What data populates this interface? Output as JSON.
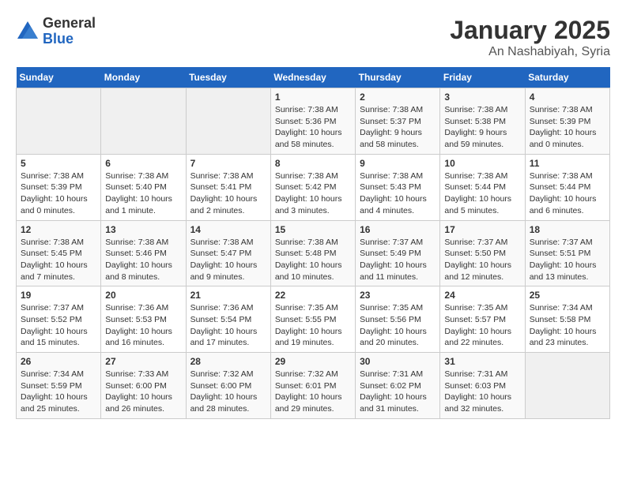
{
  "logo": {
    "general": "General",
    "blue": "Blue"
  },
  "title": "January 2025",
  "subtitle": "An Nashabiyah, Syria",
  "headers": [
    "Sunday",
    "Monday",
    "Tuesday",
    "Wednesday",
    "Thursday",
    "Friday",
    "Saturday"
  ],
  "weeks": [
    [
      {
        "day": "",
        "info": ""
      },
      {
        "day": "",
        "info": ""
      },
      {
        "day": "",
        "info": ""
      },
      {
        "day": "1",
        "info": "Sunrise: 7:38 AM\nSunset: 5:36 PM\nDaylight: 10 hours\nand 58 minutes."
      },
      {
        "day": "2",
        "info": "Sunrise: 7:38 AM\nSunset: 5:37 PM\nDaylight: 9 hours\nand 58 minutes."
      },
      {
        "day": "3",
        "info": "Sunrise: 7:38 AM\nSunset: 5:38 PM\nDaylight: 9 hours\nand 59 minutes."
      },
      {
        "day": "4",
        "info": "Sunrise: 7:38 AM\nSunset: 5:39 PM\nDaylight: 10 hours\nand 0 minutes."
      }
    ],
    [
      {
        "day": "5",
        "info": "Sunrise: 7:38 AM\nSunset: 5:39 PM\nDaylight: 10 hours\nand 0 minutes."
      },
      {
        "day": "6",
        "info": "Sunrise: 7:38 AM\nSunset: 5:40 PM\nDaylight: 10 hours\nand 1 minute."
      },
      {
        "day": "7",
        "info": "Sunrise: 7:38 AM\nSunset: 5:41 PM\nDaylight: 10 hours\nand 2 minutes."
      },
      {
        "day": "8",
        "info": "Sunrise: 7:38 AM\nSunset: 5:42 PM\nDaylight: 10 hours\nand 3 minutes."
      },
      {
        "day": "9",
        "info": "Sunrise: 7:38 AM\nSunset: 5:43 PM\nDaylight: 10 hours\nand 4 minutes."
      },
      {
        "day": "10",
        "info": "Sunrise: 7:38 AM\nSunset: 5:44 PM\nDaylight: 10 hours\nand 5 minutes."
      },
      {
        "day": "11",
        "info": "Sunrise: 7:38 AM\nSunset: 5:44 PM\nDaylight: 10 hours\nand 6 minutes."
      }
    ],
    [
      {
        "day": "12",
        "info": "Sunrise: 7:38 AM\nSunset: 5:45 PM\nDaylight: 10 hours\nand 7 minutes."
      },
      {
        "day": "13",
        "info": "Sunrise: 7:38 AM\nSunset: 5:46 PM\nDaylight: 10 hours\nand 8 minutes."
      },
      {
        "day": "14",
        "info": "Sunrise: 7:38 AM\nSunset: 5:47 PM\nDaylight: 10 hours\nand 9 minutes."
      },
      {
        "day": "15",
        "info": "Sunrise: 7:38 AM\nSunset: 5:48 PM\nDaylight: 10 hours\nand 10 minutes."
      },
      {
        "day": "16",
        "info": "Sunrise: 7:37 AM\nSunset: 5:49 PM\nDaylight: 10 hours\nand 11 minutes."
      },
      {
        "day": "17",
        "info": "Sunrise: 7:37 AM\nSunset: 5:50 PM\nDaylight: 10 hours\nand 12 minutes."
      },
      {
        "day": "18",
        "info": "Sunrise: 7:37 AM\nSunset: 5:51 PM\nDaylight: 10 hours\nand 13 minutes."
      }
    ],
    [
      {
        "day": "19",
        "info": "Sunrise: 7:37 AM\nSunset: 5:52 PM\nDaylight: 10 hours\nand 15 minutes."
      },
      {
        "day": "20",
        "info": "Sunrise: 7:36 AM\nSunset: 5:53 PM\nDaylight: 10 hours\nand 16 minutes."
      },
      {
        "day": "21",
        "info": "Sunrise: 7:36 AM\nSunset: 5:54 PM\nDaylight: 10 hours\nand 17 minutes."
      },
      {
        "day": "22",
        "info": "Sunrise: 7:35 AM\nSunset: 5:55 PM\nDaylight: 10 hours\nand 19 minutes."
      },
      {
        "day": "23",
        "info": "Sunrise: 7:35 AM\nSunset: 5:56 PM\nDaylight: 10 hours\nand 20 minutes."
      },
      {
        "day": "24",
        "info": "Sunrise: 7:35 AM\nSunset: 5:57 PM\nDaylight: 10 hours\nand 22 minutes."
      },
      {
        "day": "25",
        "info": "Sunrise: 7:34 AM\nSunset: 5:58 PM\nDaylight: 10 hours\nand 23 minutes."
      }
    ],
    [
      {
        "day": "26",
        "info": "Sunrise: 7:34 AM\nSunset: 5:59 PM\nDaylight: 10 hours\nand 25 minutes."
      },
      {
        "day": "27",
        "info": "Sunrise: 7:33 AM\nSunset: 6:00 PM\nDaylight: 10 hours\nand 26 minutes."
      },
      {
        "day": "28",
        "info": "Sunrise: 7:32 AM\nSunset: 6:00 PM\nDaylight: 10 hours\nand 28 minutes."
      },
      {
        "day": "29",
        "info": "Sunrise: 7:32 AM\nSunset: 6:01 PM\nDaylight: 10 hours\nand 29 minutes."
      },
      {
        "day": "30",
        "info": "Sunrise: 7:31 AM\nSunset: 6:02 PM\nDaylight: 10 hours\nand 31 minutes."
      },
      {
        "day": "31",
        "info": "Sunrise: 7:31 AM\nSunset: 6:03 PM\nDaylight: 10 hours\nand 32 minutes."
      },
      {
        "day": "",
        "info": ""
      }
    ]
  ]
}
